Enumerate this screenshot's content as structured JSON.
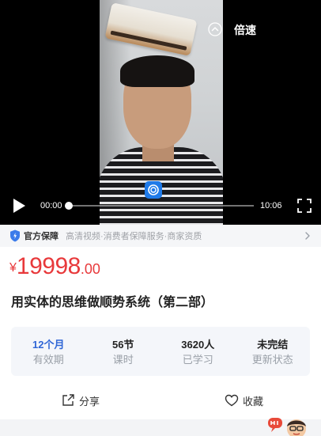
{
  "player": {
    "speed_label": "倍速",
    "current_time": "00:00",
    "total_time": "10:06",
    "progress": 0.0,
    "icons": [
      "chevron-up-circle-icon",
      "play-icon",
      "fullscreen-icon",
      "video-logo-icon"
    ]
  },
  "guarantee": {
    "title": "官方保障",
    "description": "高清视频·消费者保障服务·商家资质",
    "icons": [
      "shield-icon",
      "chevron-right-icon"
    ]
  },
  "price": {
    "currency": "¥",
    "integer": "19998",
    "decimal": ".00",
    "color": "#e8393b"
  },
  "course": {
    "title": "用实体的思维做顺势系统（第二部）"
  },
  "stats": [
    {
      "value": "12个月",
      "label": "有效期"
    },
    {
      "value": "56节",
      "label": "课时"
    },
    {
      "value": "3620人",
      "label": "已学习"
    },
    {
      "value": "未完结",
      "label": "更新状态"
    }
  ],
  "actions": {
    "share_label": "分享",
    "favorite_label": "收藏"
  },
  "colors": {
    "accent_blue": "#2f66d6",
    "price_red": "#e8393b"
  }
}
